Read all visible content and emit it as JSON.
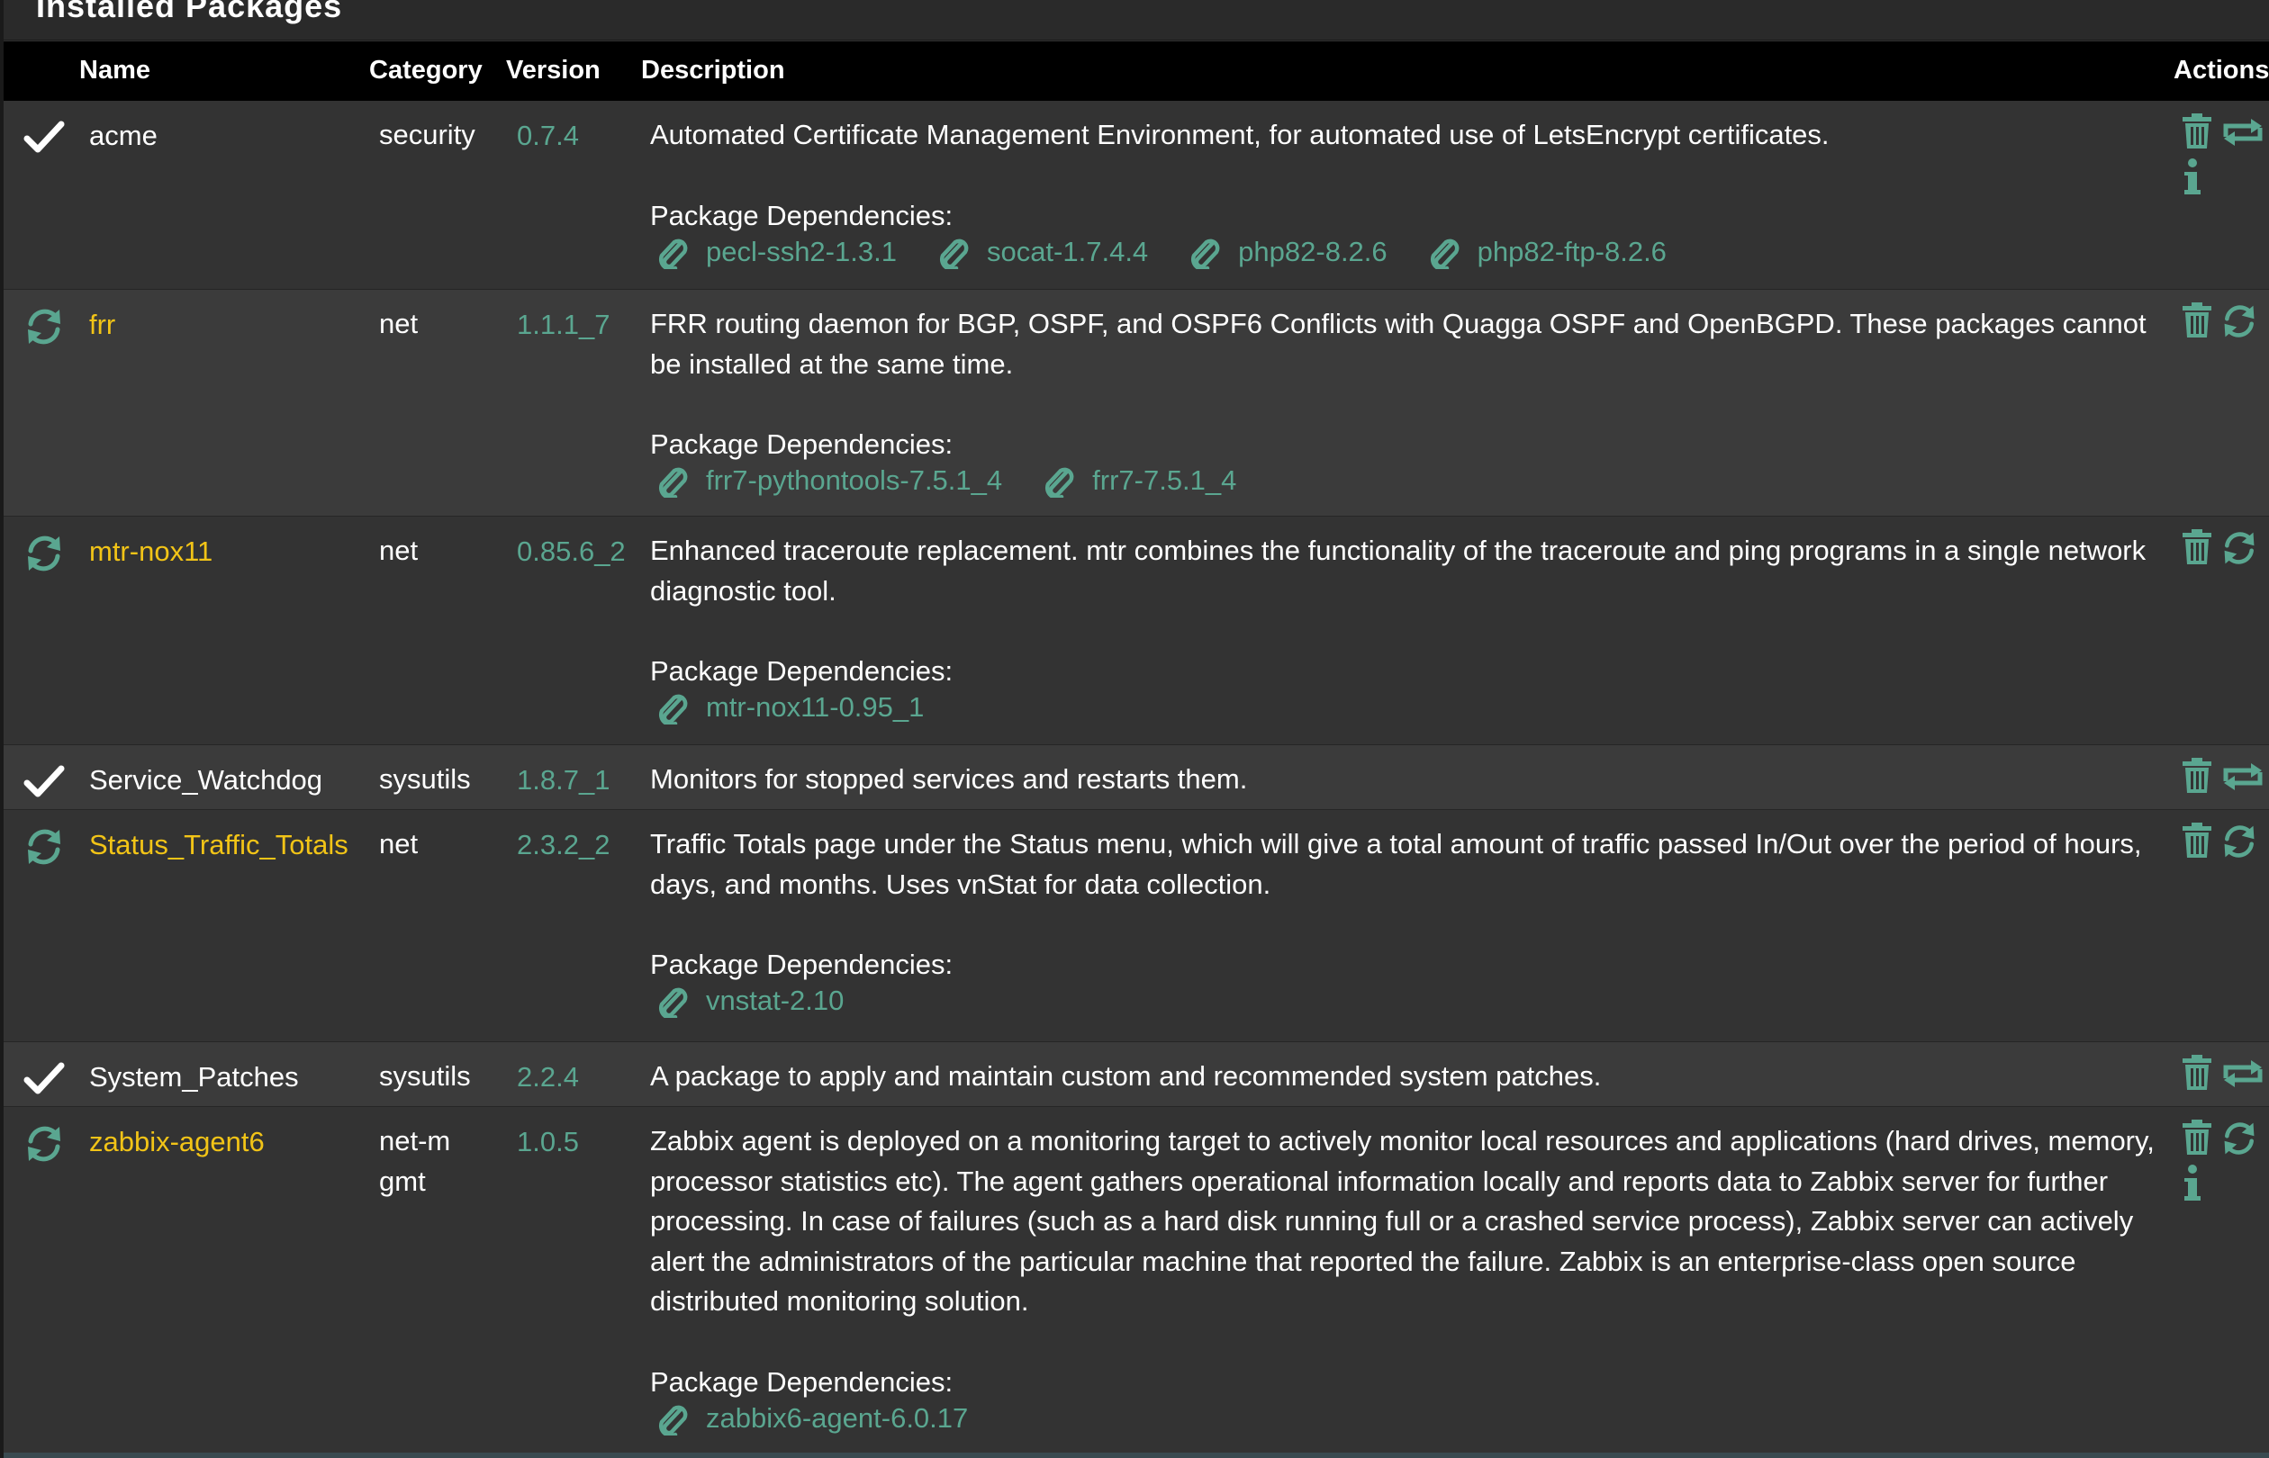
{
  "panel": {
    "title": "Installed Packages"
  },
  "columns": {
    "name": "Name",
    "category": "Category",
    "version": "Version",
    "description": "Description",
    "actions": "Actions"
  },
  "deps_label": "Package Dependencies:",
  "colors": {
    "accent_green": "#5aa690",
    "update_yellow": "#f2c417",
    "header_bg": "#000000",
    "row_bg": "#333333",
    "row_alt_bg": "#3b3b3b"
  },
  "packages": [
    {
      "status": "installed",
      "status_icon": "check-icon",
      "name": "acme",
      "category": "security",
      "version": "0.7.4",
      "description": "Automated Certificate Management Environment, for automated use of LetsEncrypt certificates.",
      "dependencies": [
        "pecl-ssh2-1.3.1",
        "socat-1.7.4.4",
        "php82-8.2.6",
        "php82-ftp-8.2.6"
      ],
      "actions": [
        "trash-icon",
        "reinstall-icon",
        "info-icon"
      ]
    },
    {
      "status": "update",
      "status_icon": "refresh-icon",
      "name": "frr",
      "category": "net",
      "version": "1.1.1_7",
      "description": "FRR routing daemon for BGP, OSPF, and OSPF6 Conflicts with Quagga OSPF and OpenBGPD. These packages cannot be installed at the same time.",
      "dependencies": [
        "frr7-pythontools-7.5.1_4",
        "frr7-7.5.1_4"
      ],
      "actions": [
        "trash-icon",
        "refresh-icon"
      ]
    },
    {
      "status": "update",
      "status_icon": "refresh-icon",
      "name": "mtr-nox11",
      "category": "net",
      "version": "0.85.6_2",
      "description": "Enhanced traceroute replacement. mtr combines the functionality of the traceroute and ping programs in a single network diagnostic tool.",
      "dependencies": [
        "mtr-nox11-0.95_1"
      ],
      "actions": [
        "trash-icon",
        "refresh-icon"
      ]
    },
    {
      "status": "installed",
      "status_icon": "check-icon",
      "name": "Service_Watchdog",
      "category": "sysutils",
      "version": "1.8.7_1",
      "description": "Monitors for stopped services and restarts them.",
      "dependencies": [],
      "actions": [
        "trash-icon",
        "reinstall-icon"
      ]
    },
    {
      "status": "update",
      "status_icon": "refresh-icon",
      "name": "Status_Traffic_Totals",
      "category": "net",
      "version": "2.3.2_2",
      "description": "Traffic Totals page under the Status menu, which will give a total amount of traffic passed In/Out over the period of hours, days, and months. Uses vnStat for data collection.",
      "dependencies": [
        "vnstat-2.10"
      ],
      "actions": [
        "trash-icon",
        "refresh-icon"
      ]
    },
    {
      "status": "installed",
      "status_icon": "check-icon",
      "name": "System_Patches",
      "category": "sysutils",
      "version": "2.2.4",
      "description": "A package to apply and maintain custom and recommended system patches.",
      "dependencies": [],
      "actions": [
        "trash-icon",
        "reinstall-icon"
      ]
    },
    {
      "status": "update",
      "status_icon": "refresh-icon",
      "name": "zabbix-agent6",
      "category": "net-mgmt",
      "version": "1.0.5",
      "description": "Zabbix agent is deployed on a monitoring target to actively monitor local resources and applications (hard drives, memory, processor statistics etc). The agent gathers operational information locally and reports data to Zabbix server for further processing. In case of failures (such as a hard disk running full or a crashed service process), Zabbix server can actively alert the administrators of the particular machine that reported the failure. Zabbix is an enterprise-class open source distributed monitoring solution.",
      "dependencies": [
        "zabbix6-agent-6.0.17"
      ],
      "actions": [
        "trash-icon",
        "refresh-icon",
        "info-icon"
      ]
    }
  ]
}
